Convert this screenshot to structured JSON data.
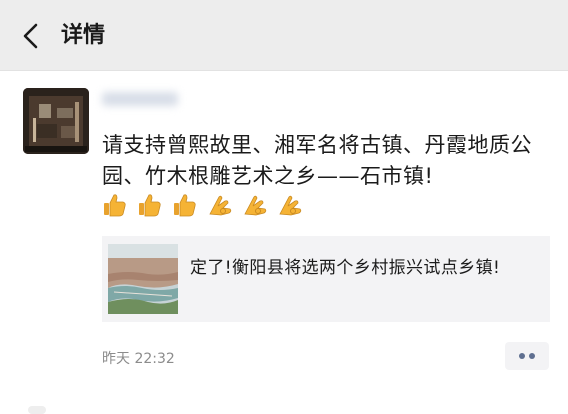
{
  "nav": {
    "title": "详情",
    "back_icon": "chevron-left-icon"
  },
  "post": {
    "avatar_icon": "avatar-photo",
    "nickname": "",
    "text": "请支持曾熙故里、湘军名将古镇、丹霞地质公园、竹木根雕艺术之乡——石市镇!",
    "emojis": [
      "thumbs-up-icon",
      "thumbs-up-icon",
      "thumbs-up-icon",
      "ok-hand-icon",
      "ok-hand-icon",
      "ok-hand-icon"
    ],
    "link": {
      "title": "定了!衡阳县将选两个乡村振兴试点乡镇!",
      "thumbnail": "aerial-town-photo"
    },
    "time": "昨天 22:32",
    "action_icon": "more-dots-icon"
  },
  "colors": {
    "nav_background": "#ededed",
    "card_background": "#f3f3f5",
    "nickname_color": "#576b95",
    "time_color": "#8c8c8c",
    "emoji_color": "#f5b335"
  }
}
